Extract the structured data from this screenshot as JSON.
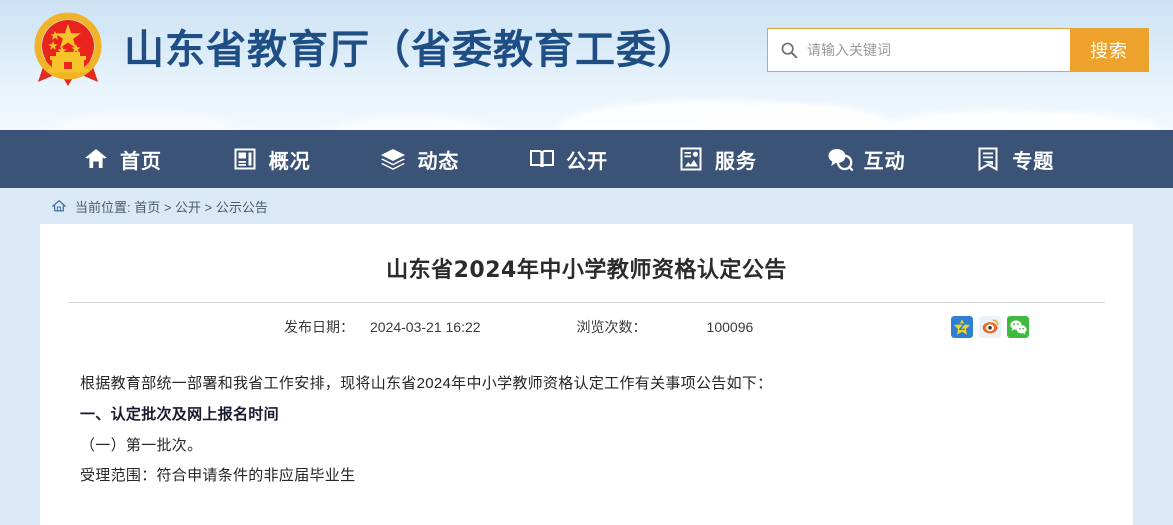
{
  "header": {
    "emblem_icon": "china-national-emblem",
    "site_title": "山东省教育厅（省委教育工委）",
    "search": {
      "icon": "search-icon",
      "placeholder": "请输入关键词",
      "value": "",
      "button_label": "搜索",
      "accent_color": "#eda22c"
    },
    "sky_color": "#cde2f4"
  },
  "nav": {
    "background_color": "#3a5377",
    "items": [
      {
        "label": "首页",
        "icon": "home-icon"
      },
      {
        "label": "概况",
        "icon": "newspaper-icon"
      },
      {
        "label": "动态",
        "icon": "layers-icon"
      },
      {
        "label": "公开",
        "icon": "open-book-icon"
      },
      {
        "label": "服务",
        "icon": "service-document-icon"
      },
      {
        "label": "互动",
        "icon": "chat-bubbles-icon"
      },
      {
        "label": "专题",
        "icon": "bookmark-document-icon"
      }
    ]
  },
  "breadcrumb": {
    "home_icon": "home-outline-icon",
    "text": "当前位置: 首页 > 公开 > 公示公告"
  },
  "article": {
    "title": "山东省2024年中小学教师资格认定公告",
    "meta": {
      "date_label": "发布日期：",
      "date_value": "2024-03-21 16:22",
      "views_label": "浏览次数：",
      "views_value": "100096"
    },
    "share_icons": [
      {
        "name": "qzone-share-icon",
        "label": "QQ空间"
      },
      {
        "name": "weibo-share-icon",
        "label": "新浪微博"
      },
      {
        "name": "wechat-share-icon",
        "label": "微信"
      }
    ],
    "paragraphs": [
      {
        "text": "根据教育部统一部署和我省工作安排，现将山东省2024年中小学教师资格认定工作有关事项公告如下：",
        "bold": false
      },
      {
        "text": "一、认定批次及网上报名时间",
        "bold": true
      },
      {
        "text": "（一）第一批次。",
        "bold": false
      },
      {
        "text": "受理范围：符合申请条件的非应届毕业生",
        "bold": false
      }
    ]
  }
}
